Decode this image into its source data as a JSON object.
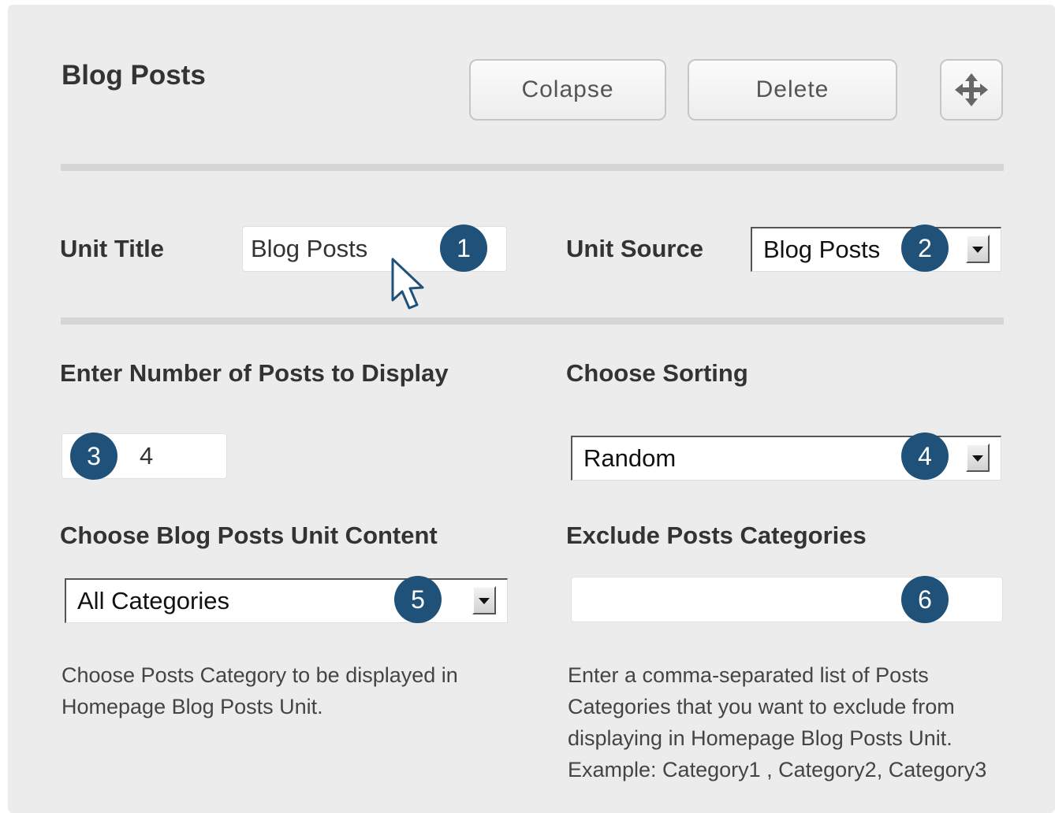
{
  "header": {
    "title": "Blog Posts",
    "collapse_label": "Colapse",
    "delete_label": "Delete"
  },
  "unit_title": {
    "label": "Unit Title",
    "value": "Blog Posts"
  },
  "unit_source": {
    "label": "Unit Source",
    "selected": "Blog Posts"
  },
  "num_posts": {
    "label": "Enter Number of Posts to Display",
    "value": "4"
  },
  "sorting": {
    "label": "Choose Sorting",
    "selected": "Random"
  },
  "content": {
    "label": "Choose Blog Posts Unit Content",
    "selected": "All Categories",
    "help_lines": [
      "Choose Posts Category to be displayed in",
      "Homepage Blog Posts Unit."
    ]
  },
  "exclude": {
    "label": "Exclude Posts Categories",
    "value": "",
    "help_lines": [
      "Enter a comma-separated list of Posts",
      "Categories that you want to exclude from",
      "displaying in Homepage Blog Posts Unit.",
      "Example: Category1 , Category2, Category3"
    ]
  },
  "badges": [
    "1",
    "2",
    "3",
    "4",
    "5",
    "6"
  ],
  "colors": {
    "panel": "#ececec",
    "badge": "#1f5179",
    "divider": "#d6d6d6"
  },
  "icons": {
    "move": "move-arrows-icon",
    "cursor": "mouse-pointer-icon",
    "dropdown": "dropdown-arrow-icon"
  }
}
